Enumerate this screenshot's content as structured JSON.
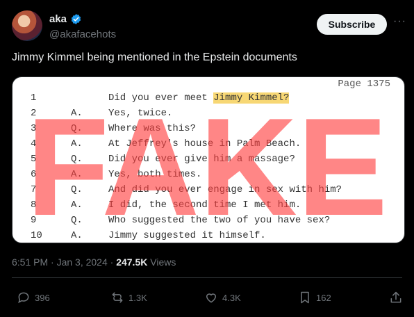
{
  "author": {
    "name": "aka",
    "handle": "@akafacehots"
  },
  "subscribe_label": "Subscribe",
  "more_label": "···",
  "tweet_text": "Jimmy Kimmel being mentioned in the Epstein documents",
  "document": {
    "page_label": "Page 1375",
    "lines": [
      {
        "num": "1",
        "speaker": "",
        "text": "Did you ever meet ",
        "highlight": "Jimmy Kimmel?"
      },
      {
        "num": "2",
        "speaker": "A.",
        "text": "Yes, twice."
      },
      {
        "num": "3",
        "speaker": "Q.",
        "text": "Where was this?"
      },
      {
        "num": "4",
        "speaker": "A.",
        "text": "At Jeffrey's house in Palm Beach."
      },
      {
        "num": "5",
        "speaker": "Q.",
        "text": "Did you ever give him a massage?"
      },
      {
        "num": "6",
        "speaker": "A.",
        "text": "Yes, both times."
      },
      {
        "num": "7",
        "speaker": "Q.",
        "text": "And did you ever engage in sex with him?"
      },
      {
        "num": "8",
        "speaker": "A.",
        "text": "I did, the second time I met him."
      },
      {
        "num": "9",
        "speaker": "Q.",
        "text": "Who suggested the two of you have sex?"
      },
      {
        "num": "10",
        "speaker": "A.",
        "text": "Jimmy suggested it himself."
      }
    ],
    "overlay_text": "FAKE",
    "overlay_color": "#ff3b3b"
  },
  "meta": {
    "time": "6:51 PM · Jan 3, 2024 · ",
    "views_count": "247.5K",
    "views_label": " Views"
  },
  "actions": {
    "replies": "396",
    "reposts": "1.3K",
    "likes": "4.3K",
    "bookmarks": "162"
  },
  "colors": {
    "verified": "#1d9bf0",
    "highlight": "#f7d774"
  }
}
